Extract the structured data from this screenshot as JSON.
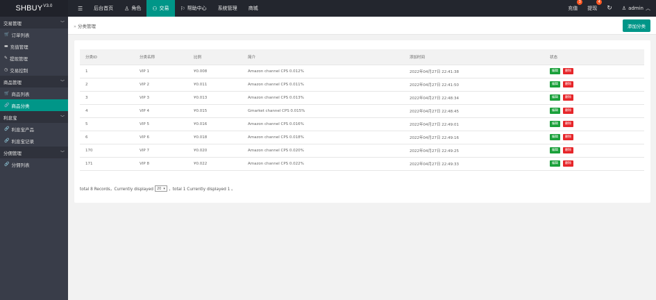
{
  "app": {
    "logo": "SHBUY",
    "version": "V3.0"
  },
  "topnav": [
    {
      "icon": "menu-icon",
      "glyph": "☰",
      "label": ""
    },
    {
      "icon": "",
      "glyph": "",
      "label": "后台首页"
    },
    {
      "icon": "user-icon",
      "glyph": "♙",
      "label": "角色"
    },
    {
      "icon": "exchange-icon",
      "glyph": "⚇",
      "label": "交易",
      "active": true
    },
    {
      "icon": "flag-icon",
      "glyph": "⚐",
      "label": "帮助中心"
    },
    {
      "icon": "",
      "glyph": "",
      "label": "系统管理"
    },
    {
      "icon": "",
      "glyph": "",
      "label": "商城"
    }
  ],
  "topright": {
    "recharge": {
      "label": "充值",
      "badge": "3"
    },
    "withdraw": {
      "label": "提现",
      "badge": "4"
    },
    "refresh_glyph": "↻",
    "user": "admin"
  },
  "sidebar": [
    {
      "type": "group",
      "label": "交易管理"
    },
    {
      "type": "item",
      "glyph": "🛒",
      "label": "订单列表"
    },
    {
      "type": "item",
      "glyph": "▬",
      "label": "充值管理"
    },
    {
      "type": "item",
      "glyph": "✎",
      "label": "提现管理"
    },
    {
      "type": "item",
      "glyph": "◷",
      "label": "交易控制"
    },
    {
      "type": "group",
      "label": "商品管理"
    },
    {
      "type": "item",
      "glyph": "🛒",
      "label": "商品列表"
    },
    {
      "type": "item",
      "glyph": "🔗",
      "label": "商品分类",
      "active": true
    },
    {
      "type": "group",
      "label": "利息宝"
    },
    {
      "type": "item",
      "glyph": "🔗",
      "label": "利息宝产品"
    },
    {
      "type": "item",
      "glyph": "🔗",
      "label": "利息宝记录"
    },
    {
      "type": "group",
      "label": "分佣管理"
    },
    {
      "type": "item",
      "glyph": "🔗",
      "label": "分佣列表"
    }
  ],
  "breadcrumb": {
    "arrow": "»",
    "label": "分类管理"
  },
  "add_button": "添加分类",
  "table": {
    "headers": [
      "分类ID",
      "分类名称",
      "比例",
      "简介",
      "添加时间",
      "状态"
    ],
    "rows": [
      {
        "id": "1",
        "name": "VIP 1",
        "ratio": "¥0.008",
        "desc": "Amazon channel CPS 0.012%",
        "time": "2022年04月27日 22:41:38"
      },
      {
        "id": "2",
        "name": "VIP 2",
        "ratio": "¥0.011",
        "desc": "Amazon channel CPS 0.011%",
        "time": "2022年04月27日 22:41:50"
      },
      {
        "id": "3",
        "name": "VIP 3",
        "ratio": "¥0.013",
        "desc": "Amazon channel CPS 0.013%",
        "time": "2022年04月27日 22:48:34"
      },
      {
        "id": "4",
        "name": "VIP 4",
        "ratio": "¥0.015",
        "desc": "Gmarket channel CPS 0.015%",
        "time": "2022年04月27日 22:48:45"
      },
      {
        "id": "5",
        "name": "VIP 5",
        "ratio": "¥0.016",
        "desc": "Amazon channel CPS 0.016%",
        "time": "2022年04月27日 22:49:01"
      },
      {
        "id": "6",
        "name": "VIP 6",
        "ratio": "¥0.018",
        "desc": "Amazon channel CPS 0.018%",
        "time": "2022年04月27日 22:49:16"
      },
      {
        "id": "170",
        "name": "VIP 7",
        "ratio": "¥0.020",
        "desc": "Amazon channel CPS 0.020%",
        "time": "2022年04月27日 22:49:25"
      },
      {
        "id": "171",
        "name": "VIP 8",
        "ratio": "¥0.022",
        "desc": "Amazon channel CPS 0.022%",
        "time": "2022年04月27日 22:49:33"
      }
    ],
    "edit_label": "编辑",
    "delete_label": "删除"
  },
  "footer": {
    "prefix": "total 8 Records，Currently displayed",
    "page_size": "20",
    "suffix": "，total 1 Currently displayed 1 。"
  },
  "colors": {
    "accent": "#009688",
    "edit": "#1aa03a",
    "delete": "#e6262a",
    "badge": "#ff5722"
  }
}
